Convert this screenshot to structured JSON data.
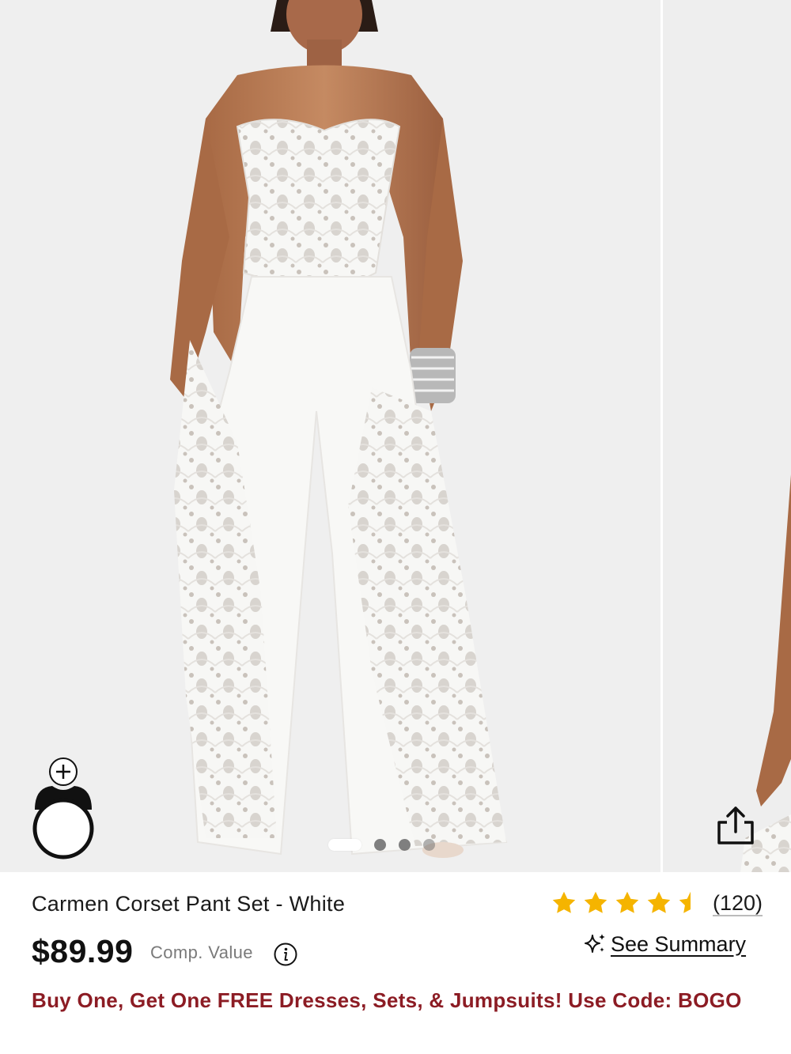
{
  "product": {
    "title": "Carmen Corset Pant Set - White",
    "price": "$89.99",
    "comp_value_label": "Comp. Value",
    "rating": 4.5,
    "review_count": "(120)",
    "summary_label": "See Summary",
    "promo": "Buy One, Get One FREE Dresses, Sets, & Jumpsuits! Use Code: BOGO"
  },
  "gallery": {
    "active_index": 0,
    "dot_count": 4
  },
  "icons": {
    "try_on": "avatar-try-on-icon",
    "share": "share-icon",
    "info": "info-icon",
    "sparkle": "sparkle-icon",
    "star": "star-icon"
  },
  "colors": {
    "promo": "#8c1c24",
    "star": "#f5b400",
    "price": "#111111"
  }
}
